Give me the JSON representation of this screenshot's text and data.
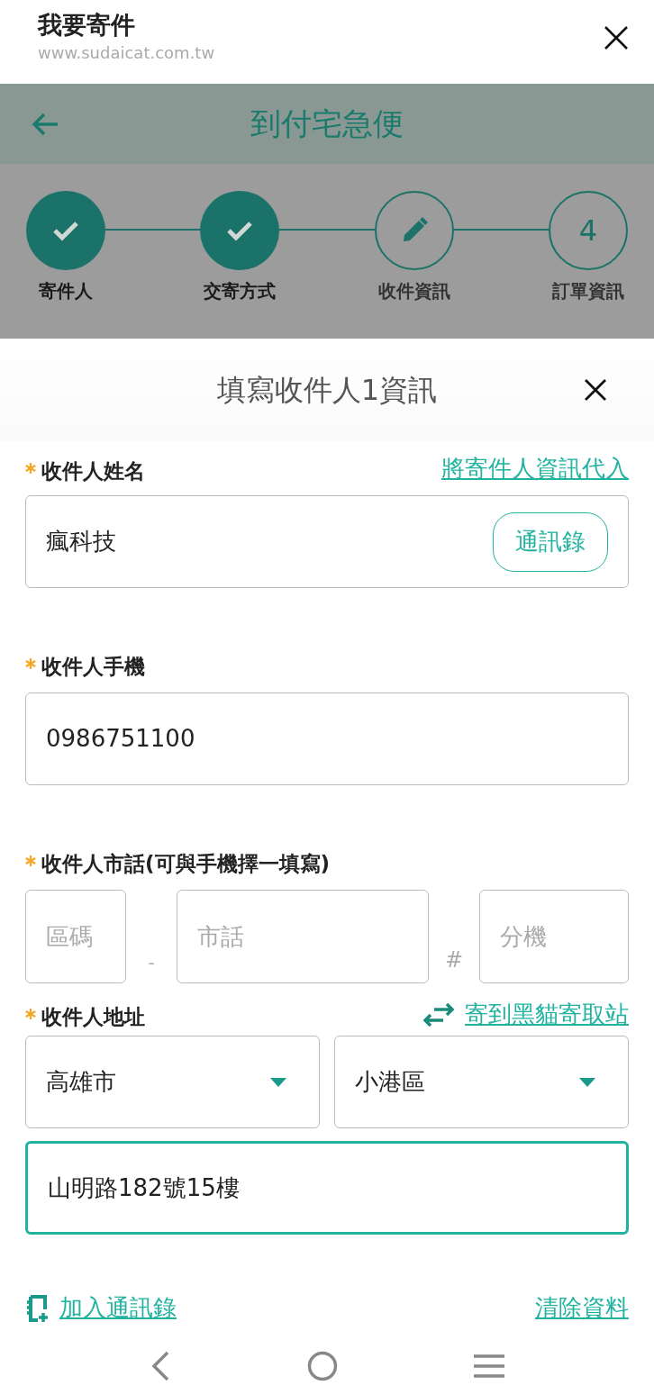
{
  "browser": {
    "title": "我要寄件",
    "url": "www.sudaicat.com.tw"
  },
  "header": {
    "title": "到付宅急便"
  },
  "steps": [
    {
      "label": "寄件人",
      "completed": true,
      "current": false
    },
    {
      "label": "交寄方式",
      "completed": true,
      "current": false
    },
    {
      "label": "收件資訊",
      "completed": false,
      "current": true
    },
    {
      "label": "訂單資訊",
      "completed": false,
      "current": false,
      "number": "4"
    }
  ],
  "sheet": {
    "title": "填寫收件人1資訊"
  },
  "name": {
    "label": "收件人姓名",
    "required": true,
    "link": "將寄件人資訊代入",
    "value": "瘋科技",
    "button": "通訊錄"
  },
  "phone": {
    "label": "收件人手機",
    "required": true,
    "value": "0986751100"
  },
  "landline": {
    "label": "收件人市話(可與手機擇一填寫)",
    "required": true,
    "area_placeholder": "區碼",
    "separator_1": "-",
    "number_placeholder": "市話",
    "separator_2": "#",
    "extension_placeholder": "分機"
  },
  "address": {
    "label": "收件人地址",
    "required": true,
    "link": "寄到黑貓寄取站",
    "city": "高雄市",
    "district": "小港區",
    "street": "山明路182號15樓",
    "street_focused": true
  },
  "footer": {
    "add_contact": "加入通訊錄",
    "clear": "清除資料"
  }
}
